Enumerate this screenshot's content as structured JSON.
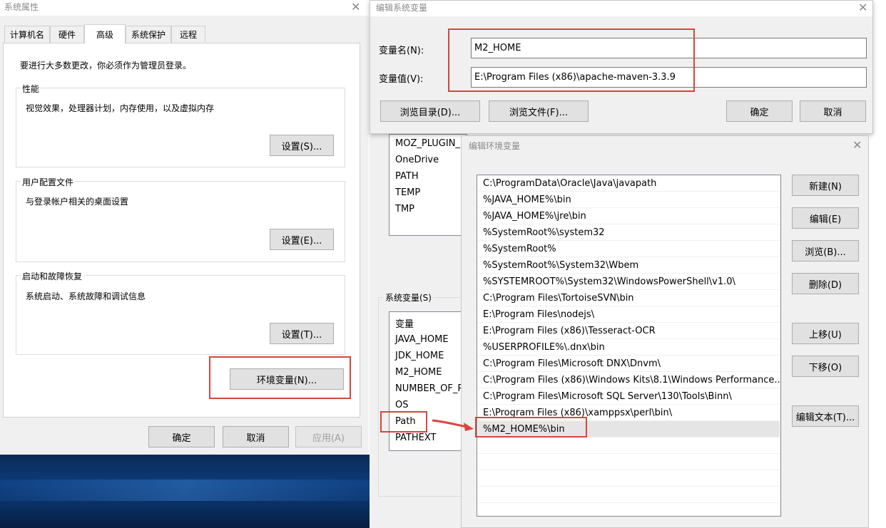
{
  "sysprops": {
    "title": "系统属性",
    "tabs": [
      "计算机名",
      "硬件",
      "高级",
      "系统保护",
      "远程"
    ],
    "admin_note": "要进行大多数更改，你必须作为管理员登录。",
    "performance": {
      "label": "性能",
      "desc": "视觉效果，处理器计划，内存使用，以及虚拟内存",
      "button": "设置(S)..."
    },
    "profiles": {
      "label": "用户配置文件",
      "desc": "与登录帐户相关的桌面设置",
      "button": "设置(E)..."
    },
    "startup": {
      "label": "启动和故障恢复",
      "desc": "系统启动、系统故障和调试信息",
      "button": "设置(T)..."
    },
    "env_button": "环境变量(N)...",
    "ok": "确定",
    "cancel": "取消",
    "apply": "应用(A)"
  },
  "editsys": {
    "title": "编辑系统变量",
    "name_label": "变量名(N):",
    "name_value": "M2_HOME",
    "value_label": "变量值(V):",
    "value_value": "E:\\Program Files (x86)\\apache-maven-3.3.9",
    "browse_dir": "浏览目录(D)...",
    "browse_file": "浏览文件(F)...",
    "ok": "确定",
    "cancel": "取消"
  },
  "envvars": {
    "user_vars": [
      "MOZ_PLUGIN_",
      "OneDrive",
      "PATH",
      "TEMP",
      "TMP"
    ],
    "sys_label": "系统变量(S)",
    "sys_header": "变量",
    "sys_vars": [
      "JAVA_HOME",
      "JDK_HOME",
      "M2_HOME",
      "NUMBER_OF_P",
      "OS",
      "Path",
      "PATHEXT"
    ]
  },
  "editenv": {
    "title": "编辑环境变量",
    "entries": [
      "C:\\ProgramData\\Oracle\\Java\\javapath",
      "%JAVA_HOME%\\bin",
      "%JAVA_HOME%\\jre\\bin",
      "%SystemRoot%\\system32",
      "%SystemRoot%",
      "%SystemRoot%\\System32\\Wbem",
      "%SYSTEMROOT%\\System32\\WindowsPowerShell\\v1.0\\",
      "C:\\Program Files\\TortoiseSVN\\bin",
      "E:\\Program Files\\nodejs\\",
      "E:\\Program Files (x86)\\Tesseract-OCR",
      "%USERPROFILE%\\.dnx\\bin",
      "C:\\Program Files\\Microsoft DNX\\Dnvm\\",
      "C:\\Program Files (x86)\\Windows Kits\\8.1\\Windows Performance...",
      "C:\\Program Files\\Microsoft SQL Server\\130\\Tools\\Binn\\",
      "E:\\Program Files (x86)\\xamppsx\\perl\\bin\\",
      "%M2_HOME%\\bin"
    ],
    "buttons": {
      "new": "新建(N)",
      "edit": "编辑(E)",
      "browse": "浏览(B)...",
      "delete": "删除(D)",
      "up": "上移(U)",
      "down": "下移(O)",
      "edit_text": "编辑文本(T)..."
    }
  },
  "colors": {
    "highlight_red": "#d9453c",
    "selected_row": "#e5e5e5"
  }
}
